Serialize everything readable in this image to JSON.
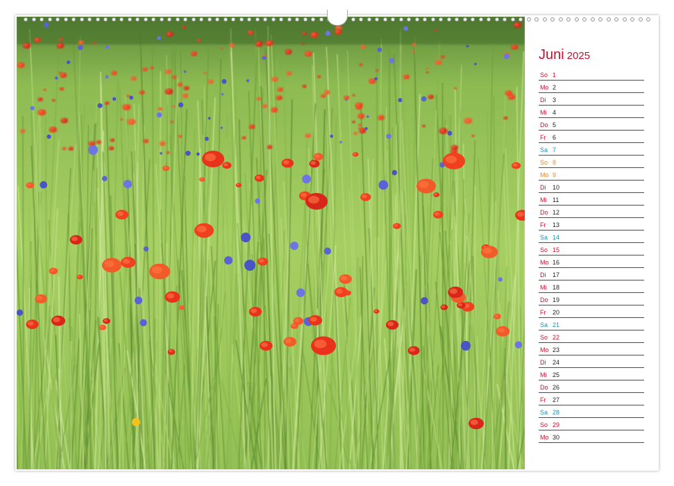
{
  "photo": {
    "subject": "poppy-meadow"
  },
  "calendar": {
    "month": "Juni",
    "year": "2025",
    "days": [
      {
        "wd": "So",
        "d": "1",
        "t": "red"
      },
      {
        "wd": "Mo",
        "d": "2",
        "t": "dark"
      },
      {
        "wd": "Di",
        "d": "3",
        "t": "dark"
      },
      {
        "wd": "Mi",
        "d": "4",
        "t": "dark"
      },
      {
        "wd": "Do",
        "d": "5",
        "t": "dark"
      },
      {
        "wd": "Fr",
        "d": "6",
        "t": "dark"
      },
      {
        "wd": "Sa",
        "d": "7",
        "t": "blue"
      },
      {
        "wd": "So",
        "d": "8",
        "t": "orange"
      },
      {
        "wd": "Mo",
        "d": "9",
        "t": "orange"
      },
      {
        "wd": "Di",
        "d": "10",
        "t": "dark"
      },
      {
        "wd": "Mi",
        "d": "11",
        "t": "dark"
      },
      {
        "wd": "Do",
        "d": "12",
        "t": "dark"
      },
      {
        "wd": "Fr",
        "d": "13",
        "t": "dark"
      },
      {
        "wd": "Sa",
        "d": "14",
        "t": "blue"
      },
      {
        "wd": "So",
        "d": "15",
        "t": "red"
      },
      {
        "wd": "Mo",
        "d": "16",
        "t": "dark"
      },
      {
        "wd": "Di",
        "d": "17",
        "t": "dark"
      },
      {
        "wd": "Mi",
        "d": "18",
        "t": "dark"
      },
      {
        "wd": "Do",
        "d": "19",
        "t": "dark"
      },
      {
        "wd": "Fr",
        "d": "20",
        "t": "dark"
      },
      {
        "wd": "Sa",
        "d": "21",
        "t": "blue"
      },
      {
        "wd": "So",
        "d": "22",
        "t": "red"
      },
      {
        "wd": "Mo",
        "d": "23",
        "t": "dark"
      },
      {
        "wd": "Di",
        "d": "24",
        "t": "dark"
      },
      {
        "wd": "Mi",
        "d": "25",
        "t": "dark"
      },
      {
        "wd": "Do",
        "d": "26",
        "t": "dark"
      },
      {
        "wd": "Fr",
        "d": "27",
        "t": "dark"
      },
      {
        "wd": "Sa",
        "d": "28",
        "t": "blue"
      },
      {
        "wd": "So",
        "d": "29",
        "t": "red"
      },
      {
        "wd": "Mo",
        "d": "30",
        "t": "dark"
      }
    ]
  },
  "colors": {
    "accent": "#c8102e",
    "saturday": "#1e8fb5",
    "holiday": "#e8892a",
    "weekday_label": "#c8102e"
  }
}
